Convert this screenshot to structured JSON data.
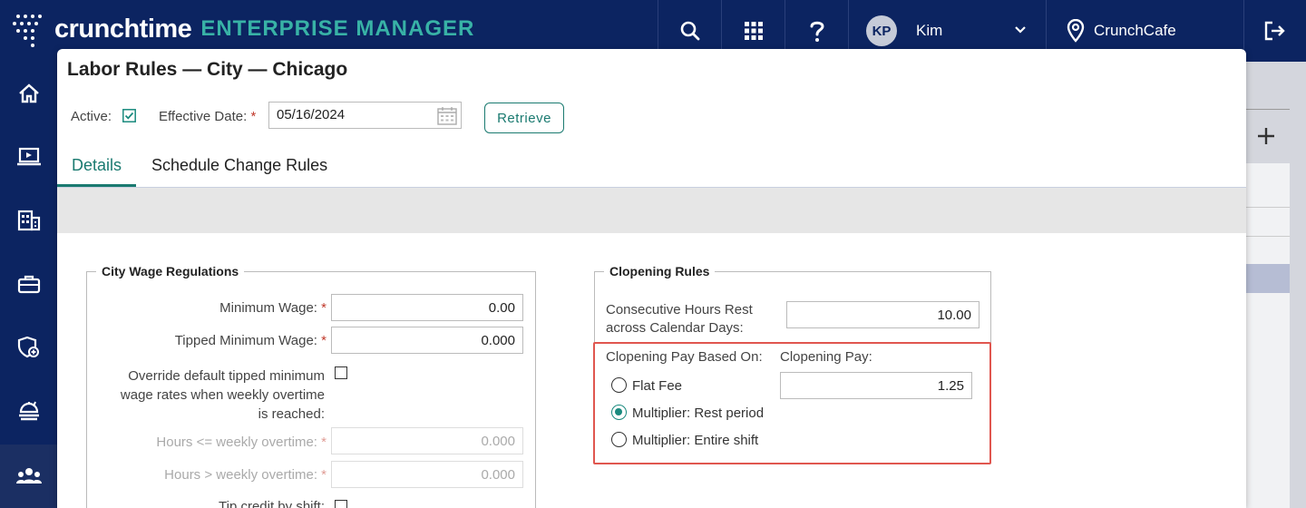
{
  "header": {
    "brand": "crunchtime",
    "product": "ENTERPRISE MANAGER",
    "user_initials": "KP",
    "user_name": "Kim",
    "location": "CrunchCafe"
  },
  "icons": {
    "search": "search-icon",
    "apps": "grid-icon",
    "help": "help-icon",
    "logout": "logout-icon",
    "location": "location-pin-icon"
  },
  "sidebar": {
    "items": [
      {
        "icon": "home-icon"
      },
      {
        "icon": "laptop-icon"
      },
      {
        "icon": "building-icon"
      },
      {
        "icon": "briefcase-icon"
      },
      {
        "icon": "shield-icon"
      },
      {
        "icon": "food-icon"
      },
      {
        "icon": "people-icon"
      }
    ]
  },
  "modal": {
    "title": "Labor Rules — City — Chicago",
    "active_label": "Active:",
    "effective_date_label": "Effective Date:",
    "required_mark": "*",
    "effective_date": "05/16/2024",
    "retrieve_label": "Retrieve",
    "tabs": [
      {
        "label": "Details"
      },
      {
        "label": "Schedule Change Rules"
      }
    ]
  },
  "wage": {
    "legend": "City Wage Regulations",
    "min_wage_label": "Minimum Wage:",
    "min_wage_value": "0.00",
    "tipped_min_label": "Tipped Minimum Wage:",
    "tipped_min_value": "0.000",
    "override_label_1": "Override default tipped minimum",
    "override_label_2": "wage rates when weekly overtime",
    "override_label_3": "is reached:",
    "hours_le_label": "Hours <= weekly overtime:",
    "hours_le_value": "0.000",
    "hours_gt_label": "Hours > weekly overtime:",
    "hours_gt_value": "0.000",
    "tip_credit_label": "Tip credit by shift:"
  },
  "clopening": {
    "legend": "Clopening Rules",
    "rest_label_1": "Consecutive Hours Rest",
    "rest_label_2": "across Calendar Days:",
    "rest_value": "10.00",
    "pay_based_label": "Clopening Pay Based On:",
    "pay_label": "Clopening Pay:",
    "pay_value": "1.25",
    "options": [
      {
        "label": "Flat Fee",
        "selected": false
      },
      {
        "label": "Multiplier: Rest period",
        "selected": true
      },
      {
        "label": "Multiplier: Entire shift",
        "selected": false
      }
    ]
  },
  "colors": {
    "navy": "#0c2461",
    "teal": "#1a7a70",
    "highlight": "#e0564f"
  }
}
